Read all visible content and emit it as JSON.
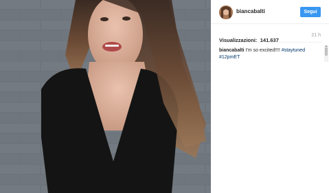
{
  "post": {
    "username": "biancabalti",
    "follow_label": "Segui",
    "views_label": "Visualizzazioni:",
    "views_count": "141.637",
    "time_ago": "21 h",
    "caption_user": "biancabalti",
    "caption_text": "I'm so excited!!!!",
    "hashtags": [
      "#staytuned",
      "#12pmET"
    ]
  },
  "colors": {
    "follow_button": "#3897f0",
    "hashtag": "#003569"
  }
}
